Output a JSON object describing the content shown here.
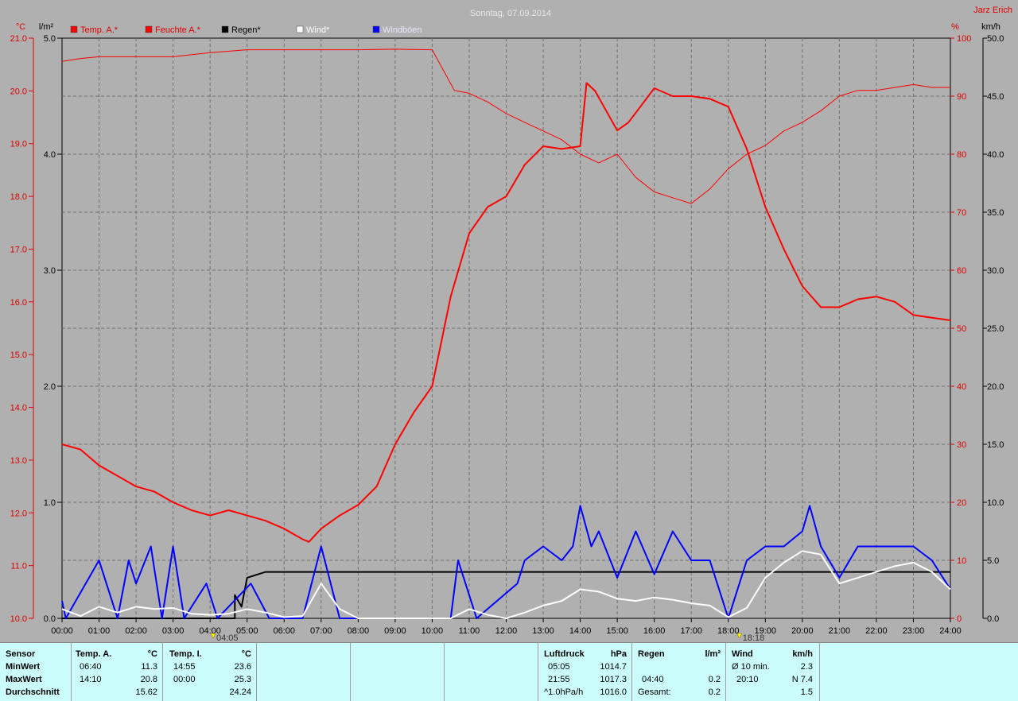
{
  "title": "Sonntag, 07.09.2014",
  "author": "Jarz Erich",
  "axis_units": {
    "temp": "°C",
    "rain": "l/m²",
    "humidity": "%",
    "wind": "km/h"
  },
  "chart_data": {
    "type": "line",
    "title": "Sonntag, 07.09.2014",
    "x_ticks": [
      "00:00",
      "01:00",
      "02:00",
      "03:00",
      "04:00",
      "05:00",
      "06:00",
      "07:00",
      "08:00",
      "09:00",
      "10:00",
      "11:00",
      "12:00",
      "13:00",
      "14:00",
      "15:00",
      "16:00",
      "17:00",
      "18:00",
      "19:00",
      "20:00",
      "21:00",
      "22:00",
      "23:00",
      "24:00"
    ],
    "x_range_hours": [
      0,
      24
    ],
    "axes": {
      "temp": {
        "label": "°C",
        "range": [
          10.0,
          21.0
        ],
        "ticks": [
          "10.0",
          "11.0",
          "12.0",
          "13.0",
          "14.0",
          "15.0",
          "16.0",
          "17.0",
          "18.0",
          "19.0",
          "20.0",
          "21.0"
        ]
      },
      "rain": {
        "label": "l/m²",
        "range": [
          0.0,
          5.0
        ],
        "ticks": [
          "0.0",
          "1.0",
          "2.0",
          "3.0",
          "4.0",
          "5.0"
        ]
      },
      "humidity": {
        "label": "%",
        "range": [
          0,
          100
        ],
        "ticks": [
          "0",
          "10",
          "20",
          "30",
          "40",
          "50",
          "60",
          "70",
          "80",
          "90",
          "100"
        ]
      },
      "wind": {
        "label": "km/h",
        "range": [
          0.0,
          50.0
        ],
        "ticks": [
          "0.0",
          "5.0",
          "10.0",
          "15.0",
          "20.0",
          "25.0",
          "30.0",
          "35.0",
          "40.0",
          "45.0",
          "50.0"
        ]
      }
    },
    "grid": true,
    "legend_position": "top-left",
    "series": [
      {
        "name": "Temp. A.*",
        "axis": "temp",
        "color": "#ff0000",
        "width": 2,
        "points": [
          [
            0,
            13.3
          ],
          [
            0.5,
            13.2
          ],
          [
            1,
            12.9
          ],
          [
            1.5,
            12.7
          ],
          [
            2,
            12.5
          ],
          [
            2.5,
            12.4
          ],
          [
            3,
            12.2
          ],
          [
            3.5,
            12.05
          ],
          [
            4,
            11.95
          ],
          [
            4.5,
            12.05
          ],
          [
            5,
            11.95
          ],
          [
            5.5,
            11.85
          ],
          [
            6,
            11.7
          ],
          [
            6.5,
            11.5
          ],
          [
            6.67,
            11.45
          ],
          [
            7,
            11.7
          ],
          [
            7.5,
            11.95
          ],
          [
            8,
            12.15
          ],
          [
            8.5,
            12.5
          ],
          [
            9,
            13.3
          ],
          [
            9.5,
            13.9
          ],
          [
            10,
            14.4
          ],
          [
            10.5,
            16.1
          ],
          [
            11,
            17.3
          ],
          [
            11.5,
            17.8
          ],
          [
            12,
            18.0
          ],
          [
            12.5,
            18.6
          ],
          [
            13,
            18.95
          ],
          [
            13.5,
            18.9
          ],
          [
            14,
            18.95
          ],
          [
            14.17,
            20.15
          ],
          [
            14.4,
            20.0
          ],
          [
            15,
            19.25
          ],
          [
            15.3,
            19.4
          ],
          [
            16,
            20.05
          ],
          [
            16.5,
            19.9
          ],
          [
            17,
            19.9
          ],
          [
            17.5,
            19.85
          ],
          [
            18,
            19.7
          ],
          [
            18.5,
            18.9
          ],
          [
            19,
            17.8
          ],
          [
            19.5,
            17.0
          ],
          [
            20,
            16.3
          ],
          [
            20.5,
            15.9
          ],
          [
            21,
            15.9
          ],
          [
            21.5,
            16.05
          ],
          [
            22,
            16.1
          ],
          [
            22.5,
            16.0
          ],
          [
            23,
            15.75
          ],
          [
            23.5,
            15.7
          ],
          [
            24,
            15.65
          ]
        ]
      },
      {
        "name": "Feuchte A.*",
        "axis": "humidity",
        "color": "#ff0000",
        "width": 1,
        "points": [
          [
            0,
            96
          ],
          [
            0.5,
            96.5
          ],
          [
            1,
            96.8
          ],
          [
            2,
            96.8
          ],
          [
            3,
            96.8
          ],
          [
            4,
            97.5
          ],
          [
            5,
            98
          ],
          [
            6,
            98
          ],
          [
            7,
            98
          ],
          [
            8,
            98
          ],
          [
            9,
            98.1
          ],
          [
            10,
            98
          ],
          [
            10.6,
            91
          ],
          [
            11,
            90.5
          ],
          [
            11.5,
            89
          ],
          [
            12,
            87
          ],
          [
            12.5,
            85.5
          ],
          [
            13,
            84
          ],
          [
            13.5,
            82.5
          ],
          [
            14,
            80
          ],
          [
            14.5,
            78.5
          ],
          [
            15,
            80
          ],
          [
            15.5,
            76
          ],
          [
            16,
            73.5
          ],
          [
            16.5,
            72.5
          ],
          [
            17,
            71.5
          ],
          [
            17.5,
            74
          ],
          [
            18,
            77.5
          ],
          [
            18.5,
            80
          ],
          [
            19,
            81.5
          ],
          [
            19.5,
            84
          ],
          [
            20,
            85.5
          ],
          [
            20.5,
            87.5
          ],
          [
            21,
            90
          ],
          [
            21.5,
            91
          ],
          [
            22,
            91
          ],
          [
            22.5,
            91.5
          ],
          [
            23,
            92
          ],
          [
            23.5,
            91.5
          ],
          [
            24,
            91.5
          ]
        ]
      },
      {
        "name": "Regen*",
        "axis": "rain",
        "color": "#000000",
        "width": 2,
        "points": [
          [
            0,
            0
          ],
          [
            4.67,
            0
          ],
          [
            4.67,
            0.2
          ],
          [
            4.85,
            0.1
          ],
          [
            5,
            0.35
          ],
          [
            5.5,
            0.4
          ],
          [
            6,
            0.4
          ],
          [
            24,
            0.4
          ]
        ]
      },
      {
        "name": "Wind*",
        "axis": "wind",
        "color": "#ffffff",
        "width": 2,
        "points": [
          [
            0,
            0.8
          ],
          [
            0.5,
            0.2
          ],
          [
            1,
            1.0
          ],
          [
            1.5,
            0.5
          ],
          [
            2,
            1.0
          ],
          [
            2.5,
            0.8
          ],
          [
            3,
            0.9
          ],
          [
            3.5,
            0.4
          ],
          [
            4,
            0.3
          ],
          [
            4.5,
            0.4
          ],
          [
            5,
            0.8
          ],
          [
            5.5,
            0.5
          ],
          [
            6,
            0.1
          ],
          [
            6.5,
            0.2
          ],
          [
            7,
            3.0
          ],
          [
            7.5,
            0.8
          ],
          [
            8,
            0
          ],
          [
            10.5,
            0
          ],
          [
            11,
            0.8
          ],
          [
            11.5,
            0.3
          ],
          [
            12,
            0
          ],
          [
            12.5,
            0.5
          ],
          [
            13,
            1.1
          ],
          [
            13.5,
            1.5
          ],
          [
            14,
            2.5
          ],
          [
            14.5,
            2.3
          ],
          [
            15,
            1.7
          ],
          [
            15.5,
            1.5
          ],
          [
            16,
            1.8
          ],
          [
            16.5,
            1.6
          ],
          [
            17,
            1.3
          ],
          [
            17.5,
            1.1
          ],
          [
            18,
            0.1
          ],
          [
            18.5,
            0.9
          ],
          [
            19,
            3.5
          ],
          [
            19.5,
            4.8
          ],
          [
            20,
            5.8
          ],
          [
            20.5,
            5.5
          ],
          [
            21,
            3.0
          ],
          [
            21.5,
            3.5
          ],
          [
            22,
            4.0
          ],
          [
            22.5,
            4.5
          ],
          [
            23,
            4.8
          ],
          [
            23.5,
            4.0
          ],
          [
            24,
            2.5
          ]
        ]
      },
      {
        "name": "Windböen",
        "axis": "wind",
        "color": "#0000ff",
        "width": 2,
        "points": [
          [
            0,
            1.5
          ],
          [
            0.1,
            0
          ],
          [
            1,
            5
          ],
          [
            1.5,
            0
          ],
          [
            1.8,
            5
          ],
          [
            2,
            3
          ],
          [
            2.4,
            6.2
          ],
          [
            2.7,
            0
          ],
          [
            3,
            6.2
          ],
          [
            3.3,
            0
          ],
          [
            3.9,
            3
          ],
          [
            4.2,
            0
          ],
          [
            5.1,
            3
          ],
          [
            5.6,
            0
          ],
          [
            6.5,
            0
          ],
          [
            7,
            6.2
          ],
          [
            7.5,
            0
          ],
          [
            10.5,
            0
          ],
          [
            10.7,
            5
          ],
          [
            11.2,
            0
          ],
          [
            12.3,
            3
          ],
          [
            12.5,
            5
          ],
          [
            13,
            6.2
          ],
          [
            13.5,
            5
          ],
          [
            13.8,
            6.2
          ],
          [
            14,
            9.7
          ],
          [
            14.3,
            6.2
          ],
          [
            14.5,
            7.5
          ],
          [
            15,
            3.5
          ],
          [
            15.5,
            7.5
          ],
          [
            16,
            3.8
          ],
          [
            16.5,
            7.5
          ],
          [
            17,
            5
          ],
          [
            17.5,
            5
          ],
          [
            18,
            0
          ],
          [
            18.5,
            5
          ],
          [
            19,
            6.2
          ],
          [
            19.5,
            6.2
          ],
          [
            20,
            7.5
          ],
          [
            20.2,
            9.7
          ],
          [
            20.5,
            6.2
          ],
          [
            21,
            3.5
          ],
          [
            21.5,
            6.2
          ],
          [
            22,
            6.2
          ],
          [
            22.5,
            6.2
          ],
          [
            23,
            6.2
          ],
          [
            23.5,
            5
          ],
          [
            24,
            2.5
          ]
        ]
      }
    ],
    "markers": [
      {
        "label": "04:05",
        "hour": 4.083
      },
      {
        "label": "18:18",
        "hour": 18.3
      }
    ]
  },
  "table": {
    "row_labels": [
      "Sensor",
      "MinWert",
      "MaxWert",
      "Durchschnitt"
    ],
    "temp_a": {
      "header": "Temp. A.",
      "unit": "°C",
      "min_time": "06:40",
      "min_val": "11.3",
      "max_time": "14:10",
      "max_val": "20.8",
      "avg": "15.62"
    },
    "temp_i": {
      "header": "Temp. I.",
      "unit": "°C",
      "min_time": "14:55",
      "min_val": "23.6",
      "max_time": "00:00",
      "max_val": "25.3",
      "avg": "24.24"
    },
    "luftdruck": {
      "header": "Luftdruck",
      "unit": "hPa",
      "min_time": "05:05",
      "min_val": "1014.7",
      "max_time": "21:55",
      "max_val": "1017.3",
      "trend_label": "^1.0hPa/h",
      "trend_val": "1016.0"
    },
    "regen": {
      "header": "Regen",
      "unit": "l/m²",
      "time": "04:40",
      "val": "0.2",
      "total_label": "Gesamt:",
      "total_val": "0.2"
    },
    "wind": {
      "header": "Wind",
      "unit": "km/h",
      "avg_label": "Ø 10 min.",
      "avg_val": "2.3",
      "max_time": "20:10",
      "max_val": "N 7.4",
      "extra_val": "1.5"
    }
  }
}
